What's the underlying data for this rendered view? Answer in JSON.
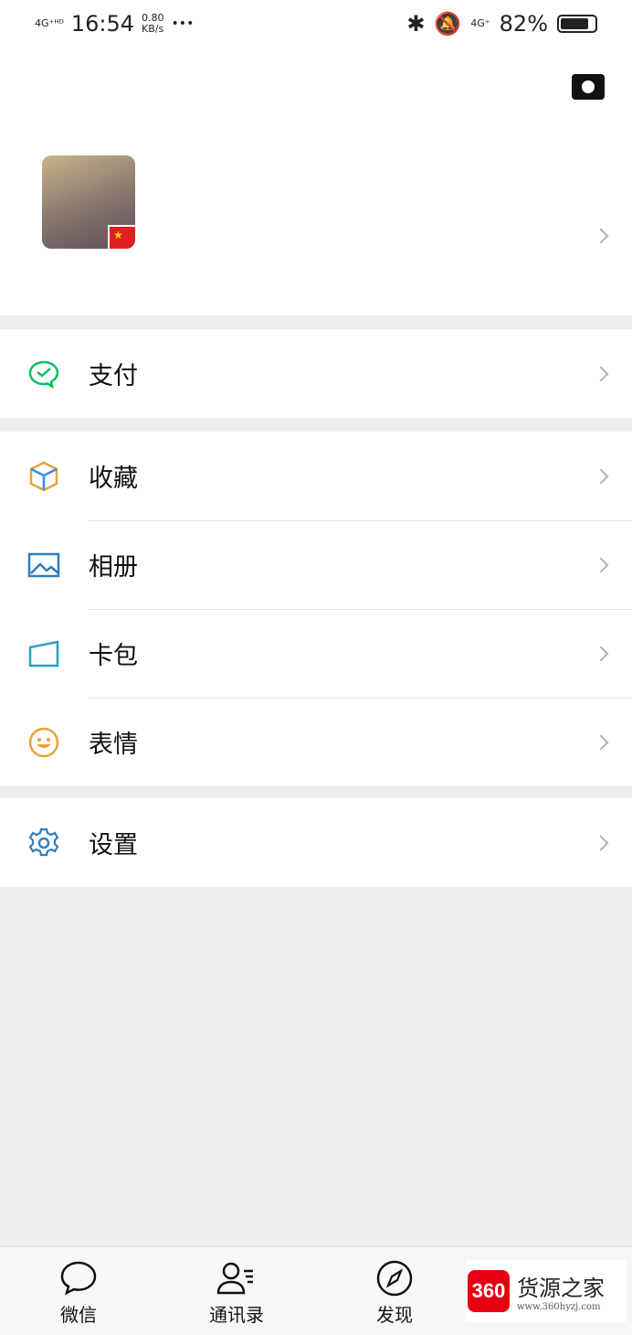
{
  "status_bar": {
    "network_left": "4G⁺ᴴᴰ",
    "time": "16:54",
    "speed_value": "0.80",
    "speed_unit": "KB/s",
    "dots": "•••",
    "network_right": "4G⁺",
    "battery": "82%",
    "battery_level": 0.82
  },
  "profile": {
    "camera_icon": "camera-icon",
    "flag": "★"
  },
  "menu": {
    "pay": {
      "label": "支付",
      "icon": "wechat-pay-icon",
      "color": "#07c160"
    },
    "group": [
      {
        "label": "收藏",
        "icon": "cube-icon"
      },
      {
        "label": "相册",
        "icon": "image-icon"
      },
      {
        "label": "卡包",
        "icon": "card-icon"
      },
      {
        "label": "表情",
        "icon": "smiley-icon"
      }
    ],
    "settings": {
      "label": "设置",
      "icon": "gear-icon"
    }
  },
  "tabbar": {
    "tabs": [
      {
        "label": "微信",
        "icon": "chat-bubble-icon"
      },
      {
        "label": "通讯录",
        "icon": "contacts-icon"
      },
      {
        "label": "发现",
        "icon": "compass-icon"
      }
    ]
  },
  "watermark": {
    "logo": "360",
    "title": "货源之家",
    "url": "www.360hyzj.com"
  }
}
